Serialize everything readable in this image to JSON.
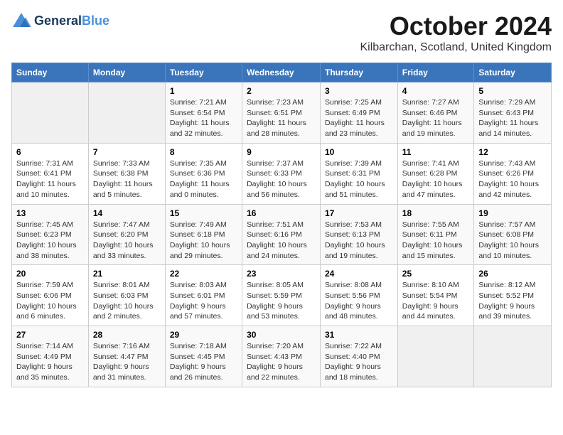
{
  "header": {
    "logo_line1": "General",
    "logo_line2": "Blue",
    "month": "October 2024",
    "location": "Kilbarchan, Scotland, United Kingdom"
  },
  "days_of_week": [
    "Sunday",
    "Monday",
    "Tuesday",
    "Wednesday",
    "Thursday",
    "Friday",
    "Saturday"
  ],
  "weeks": [
    [
      {
        "num": "",
        "detail": ""
      },
      {
        "num": "",
        "detail": ""
      },
      {
        "num": "1",
        "detail": "Sunrise: 7:21 AM\nSunset: 6:54 PM\nDaylight: 11 hours\nand 32 minutes."
      },
      {
        "num": "2",
        "detail": "Sunrise: 7:23 AM\nSunset: 6:51 PM\nDaylight: 11 hours\nand 28 minutes."
      },
      {
        "num": "3",
        "detail": "Sunrise: 7:25 AM\nSunset: 6:49 PM\nDaylight: 11 hours\nand 23 minutes."
      },
      {
        "num": "4",
        "detail": "Sunrise: 7:27 AM\nSunset: 6:46 PM\nDaylight: 11 hours\nand 19 minutes."
      },
      {
        "num": "5",
        "detail": "Sunrise: 7:29 AM\nSunset: 6:43 PM\nDaylight: 11 hours\nand 14 minutes."
      }
    ],
    [
      {
        "num": "6",
        "detail": "Sunrise: 7:31 AM\nSunset: 6:41 PM\nDaylight: 11 hours\nand 10 minutes."
      },
      {
        "num": "7",
        "detail": "Sunrise: 7:33 AM\nSunset: 6:38 PM\nDaylight: 11 hours\nand 5 minutes."
      },
      {
        "num": "8",
        "detail": "Sunrise: 7:35 AM\nSunset: 6:36 PM\nDaylight: 11 hours\nand 0 minutes."
      },
      {
        "num": "9",
        "detail": "Sunrise: 7:37 AM\nSunset: 6:33 PM\nDaylight: 10 hours\nand 56 minutes."
      },
      {
        "num": "10",
        "detail": "Sunrise: 7:39 AM\nSunset: 6:31 PM\nDaylight: 10 hours\nand 51 minutes."
      },
      {
        "num": "11",
        "detail": "Sunrise: 7:41 AM\nSunset: 6:28 PM\nDaylight: 10 hours\nand 47 minutes."
      },
      {
        "num": "12",
        "detail": "Sunrise: 7:43 AM\nSunset: 6:26 PM\nDaylight: 10 hours\nand 42 minutes."
      }
    ],
    [
      {
        "num": "13",
        "detail": "Sunrise: 7:45 AM\nSunset: 6:23 PM\nDaylight: 10 hours\nand 38 minutes."
      },
      {
        "num": "14",
        "detail": "Sunrise: 7:47 AM\nSunset: 6:20 PM\nDaylight: 10 hours\nand 33 minutes."
      },
      {
        "num": "15",
        "detail": "Sunrise: 7:49 AM\nSunset: 6:18 PM\nDaylight: 10 hours\nand 29 minutes."
      },
      {
        "num": "16",
        "detail": "Sunrise: 7:51 AM\nSunset: 6:16 PM\nDaylight: 10 hours\nand 24 minutes."
      },
      {
        "num": "17",
        "detail": "Sunrise: 7:53 AM\nSunset: 6:13 PM\nDaylight: 10 hours\nand 19 minutes."
      },
      {
        "num": "18",
        "detail": "Sunrise: 7:55 AM\nSunset: 6:11 PM\nDaylight: 10 hours\nand 15 minutes."
      },
      {
        "num": "19",
        "detail": "Sunrise: 7:57 AM\nSunset: 6:08 PM\nDaylight: 10 hours\nand 10 minutes."
      }
    ],
    [
      {
        "num": "20",
        "detail": "Sunrise: 7:59 AM\nSunset: 6:06 PM\nDaylight: 10 hours\nand 6 minutes."
      },
      {
        "num": "21",
        "detail": "Sunrise: 8:01 AM\nSunset: 6:03 PM\nDaylight: 10 hours\nand 2 minutes."
      },
      {
        "num": "22",
        "detail": "Sunrise: 8:03 AM\nSunset: 6:01 PM\nDaylight: 9 hours\nand 57 minutes."
      },
      {
        "num": "23",
        "detail": "Sunrise: 8:05 AM\nSunset: 5:59 PM\nDaylight: 9 hours\nand 53 minutes."
      },
      {
        "num": "24",
        "detail": "Sunrise: 8:08 AM\nSunset: 5:56 PM\nDaylight: 9 hours\nand 48 minutes."
      },
      {
        "num": "25",
        "detail": "Sunrise: 8:10 AM\nSunset: 5:54 PM\nDaylight: 9 hours\nand 44 minutes."
      },
      {
        "num": "26",
        "detail": "Sunrise: 8:12 AM\nSunset: 5:52 PM\nDaylight: 9 hours\nand 39 minutes."
      }
    ],
    [
      {
        "num": "27",
        "detail": "Sunrise: 7:14 AM\nSunset: 4:49 PM\nDaylight: 9 hours\nand 35 minutes."
      },
      {
        "num": "28",
        "detail": "Sunrise: 7:16 AM\nSunset: 4:47 PM\nDaylight: 9 hours\nand 31 minutes."
      },
      {
        "num": "29",
        "detail": "Sunrise: 7:18 AM\nSunset: 4:45 PM\nDaylight: 9 hours\nand 26 minutes."
      },
      {
        "num": "30",
        "detail": "Sunrise: 7:20 AM\nSunset: 4:43 PM\nDaylight: 9 hours\nand 22 minutes."
      },
      {
        "num": "31",
        "detail": "Sunrise: 7:22 AM\nSunset: 4:40 PM\nDaylight: 9 hours\nand 18 minutes."
      },
      {
        "num": "",
        "detail": ""
      },
      {
        "num": "",
        "detail": ""
      }
    ]
  ]
}
